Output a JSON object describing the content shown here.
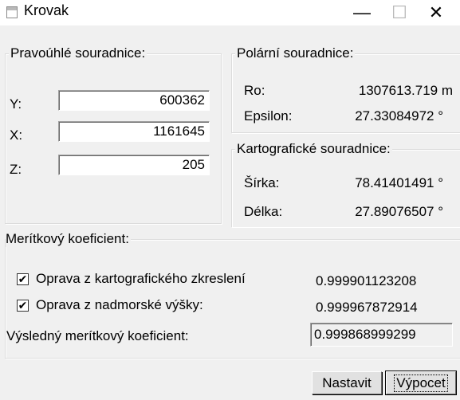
{
  "window": {
    "title": "Krovak",
    "minimize": "—",
    "maximize": "☐",
    "close": "✕"
  },
  "rectangular": {
    "title": "Pravoúhlé souradnice:",
    "y_label": "Y:",
    "y_value": "600362",
    "x_label": "X:",
    "x_value": "1161645",
    "z_label": "Z:",
    "z_value": "205"
  },
  "polar": {
    "title": "Polární souradnice:",
    "ro_label": "Ro:",
    "ro_value": "1307613.719 m",
    "epsilon_label": "Epsilon:",
    "epsilon_value": "27.33084972 °"
  },
  "cartographic": {
    "title": "Kartografické souradnice:",
    "sirka_label": "Šírka:",
    "sirka_value": "78.41401491 °",
    "delka_label": "Délka:",
    "delka_value": "27.89076507 °"
  },
  "scale": {
    "title": "Merítkový koeficient:",
    "check1_label": "Oprava z kartografického zkreslení",
    "check1_checked": true,
    "check1_value": "0.999901123208",
    "check2_label": "Oprava z nadmorské výšky:",
    "check2_checked": true,
    "check2_value": "0.999967872914",
    "result_label": "Výsledný merítkový koeficient:",
    "result_value": "0.999868999299"
  },
  "buttons": {
    "nastavit": "Nastavit",
    "vypocet": "Výpocet"
  },
  "icons": {
    "check_glyph": "✔"
  }
}
